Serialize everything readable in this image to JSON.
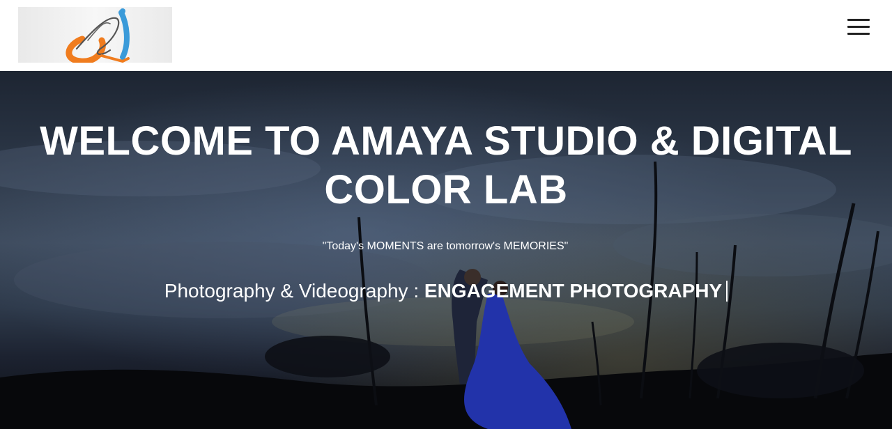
{
  "header": {
    "logo_alt": "Amaya Studio logo",
    "menu_icon": "hamburger-menu-icon"
  },
  "hero": {
    "title": "WELCOME TO AMAYA STUDIO & DIGITAL COLOR LAB",
    "quote": "\"Today's MOMENTS are tomorrow's MEMORIES\"",
    "service_prefix": "Photography & Videography :",
    "service_highlight": "ENGAGEMENT PHOTOGRAPHY"
  },
  "colors": {
    "header_bg": "#ffffff",
    "menu_icon": "#222222",
    "hero_text": "#ffffff",
    "logo_orange": "#f07c1e",
    "logo_blue": "#3a9ad9"
  }
}
